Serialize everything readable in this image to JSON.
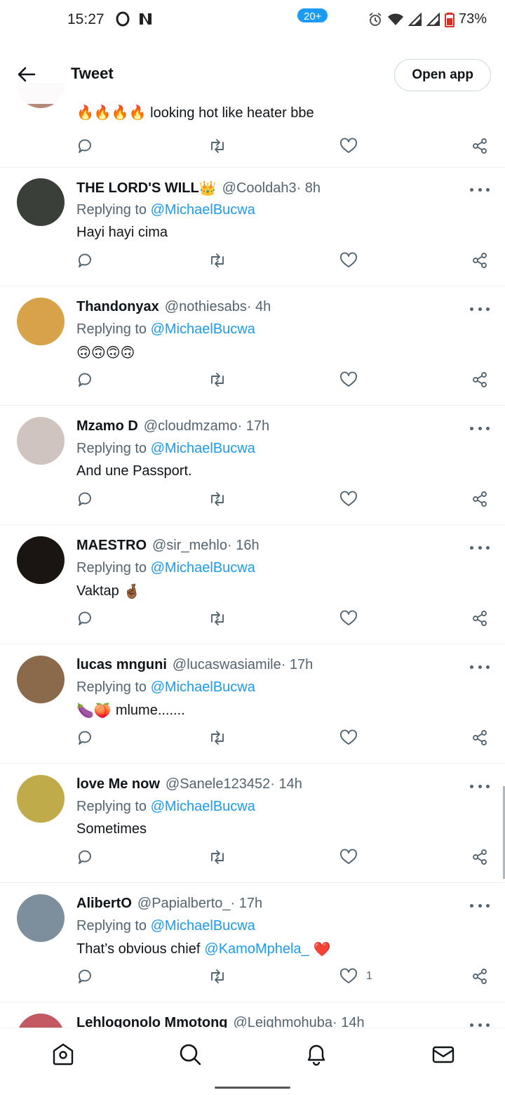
{
  "status_bar": {
    "time": "15:27",
    "battery": "73%"
  },
  "header": {
    "title": "Tweet",
    "open_app_label": "Open app"
  },
  "partial_tweet": {
    "text": "looking hot like heater bbe",
    "emoji": "🔥🔥🔥🔥"
  },
  "replying_prefix": "Replying to",
  "tweets": [
    {
      "name": "THE LORD'S WILL",
      "name_emoji": "👑",
      "handle": "@Cooldah3",
      "time": " · 8h",
      "replying_to": "@MichaelBucwa",
      "text": "Hayi hayi cima",
      "avatar_color": "#3a3f3a"
    },
    {
      "name": "Thandonyax",
      "handle": "@nothiesabs",
      "time": " · 4h",
      "replying_to": "@MichaelBucwa",
      "text_emoji": "🙃🙃🙃🙃",
      "avatar_color": "#d7a24a"
    },
    {
      "name": "Mzamo D",
      "handle": "@cloudmzamo",
      "time": " · 17h",
      "replying_to": "@MichaelBucwa",
      "text": "And une Passport.",
      "avatar_color": "#cfc4c0"
    },
    {
      "name": "MAESTRO",
      "handle": "@sir_mehlo",
      "time": " · 16h",
      "replying_to": "@MichaelBucwa",
      "text": "Vaktap",
      "text_emoji": "🤞🏾",
      "avatar_color": "#1a1412"
    },
    {
      "name": "lucas mnguni",
      "handle": "@lucaswasiamile",
      "time": " · 17h",
      "replying_to": "@MichaelBucwa",
      "text_emoji": "🍆🍑",
      "text": "mlume.......",
      "avatar_color": "#8a6a4a"
    },
    {
      "name": "love Me now",
      "handle": "@Sanele123452",
      "time": " · 14h",
      "replying_to": "@MichaelBucwa",
      "text": "Sometimes",
      "avatar_color": "#c0ab4a"
    },
    {
      "name": "AlibertO",
      "handle": "@Papialberto_",
      "time": " · 17h",
      "replying_to": "@MichaelBucwa",
      "text": "That’s obvious chief",
      "text_mention": "@KamoMphela_",
      "text_emoji": "❤️",
      "like_count": "1",
      "avatar_color": "#7d8f9c"
    }
  ],
  "last_tweet_partial": {
    "name": "Lehlogonolo Mmotong",
    "handle": "@Leighmohuba",
    "time": " · 14h"
  },
  "bottom_nav": {
    "badge": "20+"
  },
  "colors": {
    "accent": "#1d9bf0",
    "text_primary": "#0f1419",
    "text_secondary": "#536471",
    "divider": "#eff3f4",
    "heart_red": "#e0245e"
  },
  "icons": [
    "back-arrow-icon",
    "reply-icon",
    "retweet-icon",
    "like-icon",
    "share-icon",
    "more-icon",
    "home-icon",
    "search-icon",
    "notifications-icon",
    "messages-icon",
    "alarm-icon",
    "wifi-icon",
    "signal-icon",
    "battery-icon"
  ]
}
